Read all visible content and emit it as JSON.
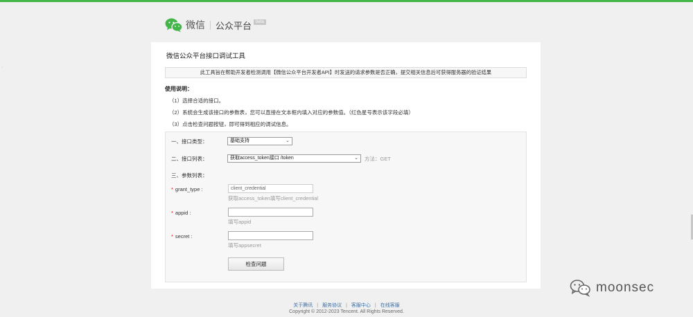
{
  "header": {
    "logo_name": "微信",
    "platform": "公众平台",
    "beta": "beta"
  },
  "page": {
    "title": "微信公众平台接口调试工具",
    "notice": "此工具旨在帮助开发者检测调用【微信公众平台开发者API】时发送的请求参数是否正确，提交相关信息后可获得服务器的验证结果",
    "usage_title": "使用说明：",
    "usage": [
      "（1）选择合适的接口。",
      "（2）系统会生成该接口的参数表，您可以直接在文本框内填入对应的参数值。（红色星号表示该字段必填）",
      "（3）点击检查问题按钮，即可得到相应的调试信息。"
    ]
  },
  "form": {
    "type_label": "一、接口类型：",
    "type_value": "基础支持",
    "list_label": "二、接口列表：",
    "list_value": "获取access_token接口 /token",
    "method": "方法：GET",
    "params_label": "三、参数列表：",
    "required_mark": "*",
    "params": [
      {
        "label": "grant_type :",
        "value": "client_credential",
        "hint": "获取access_token填写client_credential"
      },
      {
        "label": "appid :",
        "value": "",
        "hint": "填写appid"
      },
      {
        "label": "secret :",
        "value": "",
        "hint": "填写appsecret"
      }
    ],
    "check_button": "检查问题"
  },
  "footer": {
    "links": [
      "关于腾讯",
      "服务协议",
      "客服中心",
      "在线客服"
    ],
    "copyright": "Copyright © 2012-2023 Tencent. All Rights Reserved."
  },
  "watermark": {
    "text": "moonsec"
  },
  "icons": {
    "logo": "wechat-logo-icon",
    "dropdown": "chevron-down-icon",
    "watermark": "wechat-outline-icon"
  },
  "colors": {
    "accent": "#44b549",
    "required": "#ee0000",
    "link": "#3a6ea5"
  }
}
